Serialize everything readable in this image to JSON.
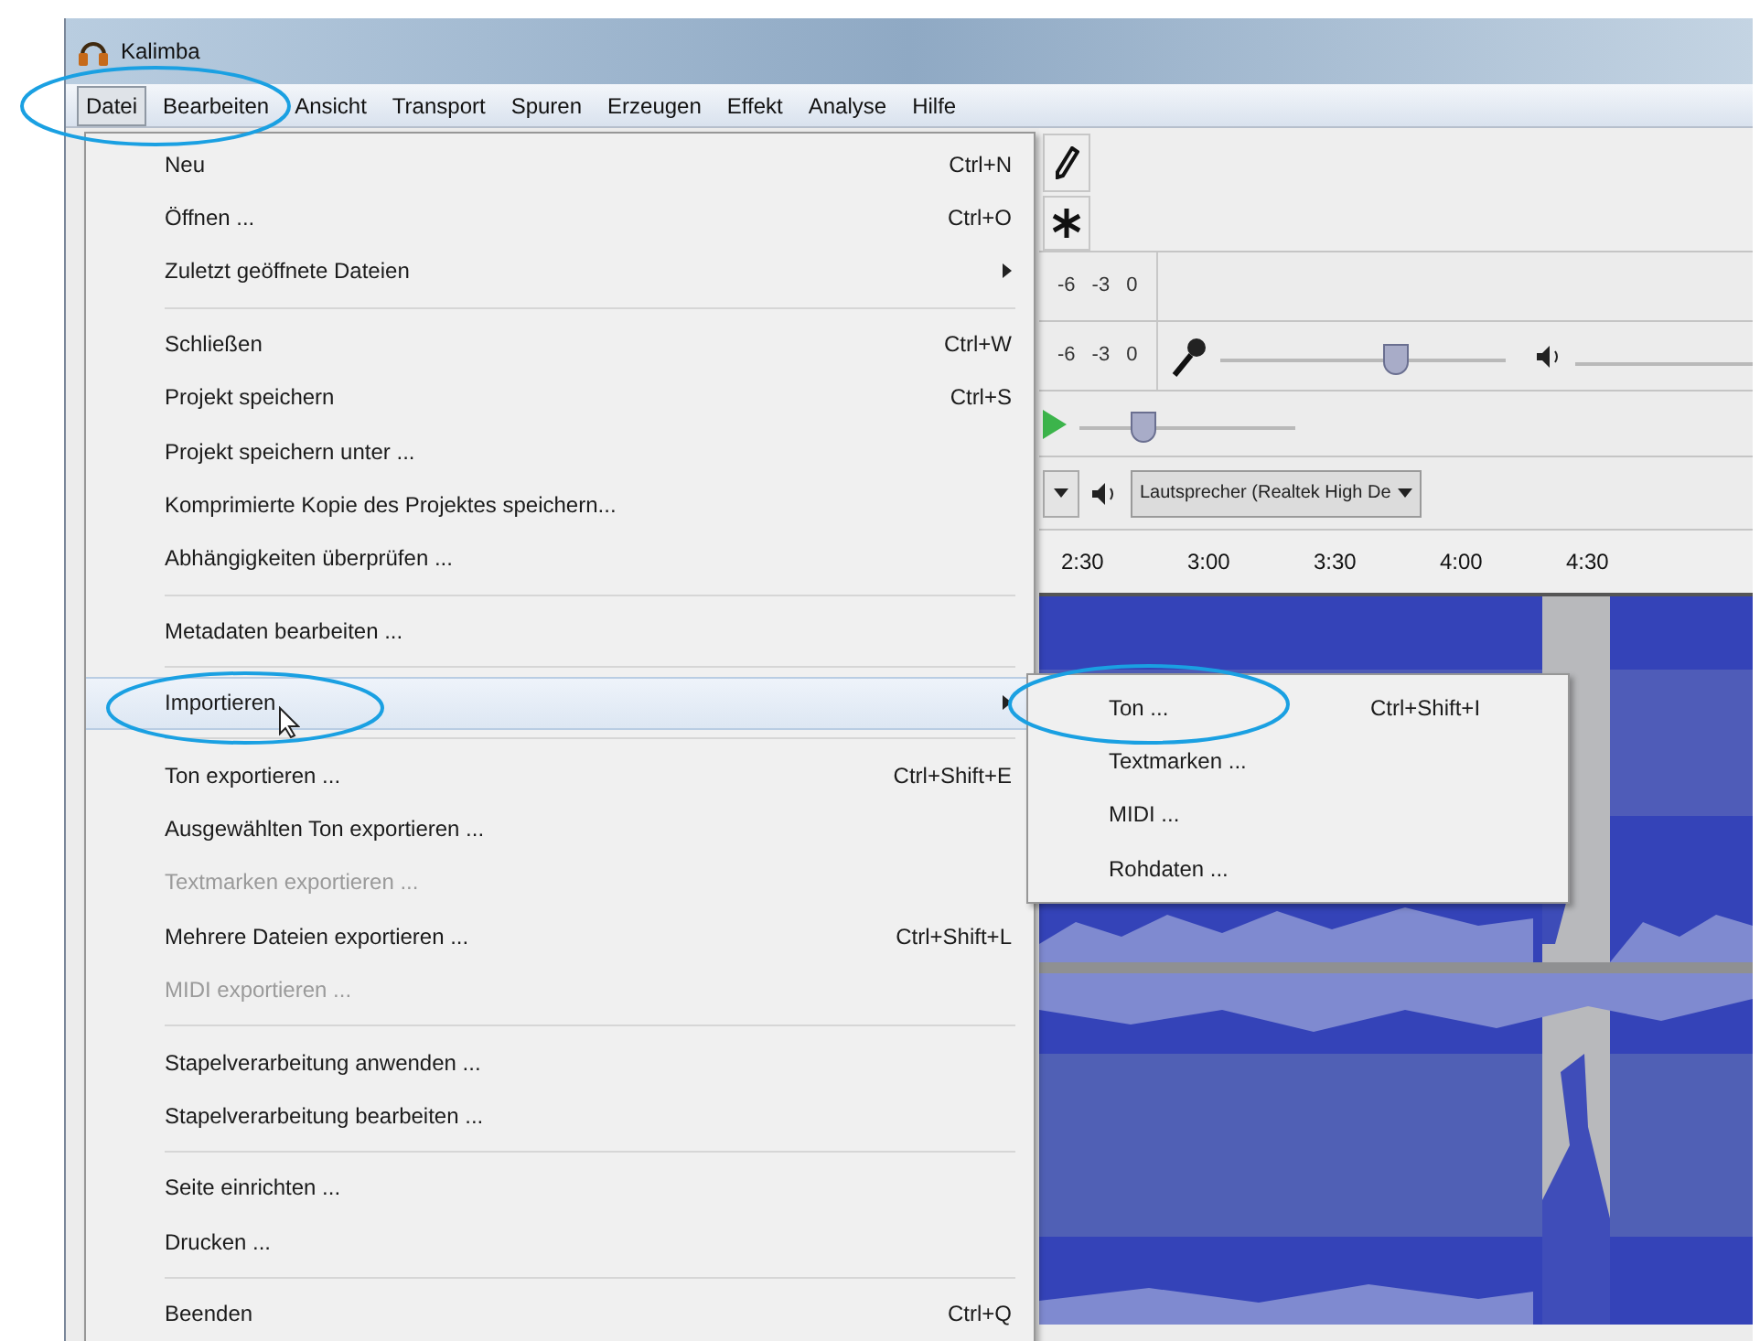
{
  "window": {
    "title": "Kalimba"
  },
  "menu_bar": [
    {
      "label": "Datei",
      "selected": true
    },
    {
      "label": "Bearbeiten",
      "selected": false
    },
    {
      "label": "Ansicht",
      "selected": false
    },
    {
      "label": "Transport",
      "selected": false
    },
    {
      "label": "Spuren",
      "selected": false
    },
    {
      "label": "Erzeugen",
      "selected": false
    },
    {
      "label": "Effekt",
      "selected": false
    },
    {
      "label": "Analyse",
      "selected": false
    },
    {
      "label": "Hilfe",
      "selected": false
    }
  ],
  "file_menu": [
    {
      "kind": "item",
      "label": "Neu",
      "shortcut": "Ctrl+N",
      "disabled": false,
      "selected": false,
      "submenu": false
    },
    {
      "kind": "item",
      "label": "Öffnen ...",
      "shortcut": "Ctrl+O",
      "disabled": false,
      "selected": false,
      "submenu": false
    },
    {
      "kind": "item",
      "label": "Zuletzt geöffnete Dateien",
      "disabled": false,
      "selected": false,
      "submenu": true
    },
    {
      "kind": "separator"
    },
    {
      "kind": "item",
      "label": "Schließen",
      "shortcut": "Ctrl+W",
      "disabled": false,
      "selected": false,
      "submenu": false
    },
    {
      "kind": "item",
      "label": "Projekt speichern",
      "shortcut": "Ctrl+S",
      "disabled": false,
      "selected": false,
      "submenu": false
    },
    {
      "kind": "item",
      "label": "Projekt speichern unter ...",
      "disabled": false,
      "selected": false,
      "submenu": false
    },
    {
      "kind": "item",
      "label": "Komprimierte Kopie des Projektes speichern...",
      "disabled": false,
      "selected": false,
      "submenu": false
    },
    {
      "kind": "item",
      "label": "Abhängigkeiten überprüfen ...",
      "disabled": false,
      "selected": false,
      "submenu": false
    },
    {
      "kind": "separator"
    },
    {
      "kind": "item",
      "label": "Metadaten bearbeiten ...",
      "disabled": false,
      "selected": false,
      "submenu": false
    },
    {
      "kind": "separator"
    },
    {
      "kind": "item",
      "label": "Importieren",
      "disabled": false,
      "selected": true,
      "submenu": true
    },
    {
      "kind": "separator"
    },
    {
      "kind": "item",
      "label": "Ton exportieren ...",
      "shortcut": "Ctrl+Shift+E",
      "disabled": false,
      "selected": false,
      "submenu": false
    },
    {
      "kind": "item",
      "label": "Ausgewählten Ton exportieren ...",
      "disabled": false,
      "selected": false,
      "submenu": false
    },
    {
      "kind": "item",
      "label": "Textmarken exportieren ...",
      "disabled": true,
      "selected": false,
      "submenu": false
    },
    {
      "kind": "item",
      "label": "Mehrere Dateien exportieren ...",
      "shortcut": "Ctrl+Shift+L",
      "disabled": false,
      "selected": false,
      "submenu": false
    },
    {
      "kind": "item",
      "label": "MIDI exportieren ...",
      "disabled": true,
      "selected": false,
      "submenu": false
    },
    {
      "kind": "separator"
    },
    {
      "kind": "item",
      "label": "Stapelverarbeitung anwenden ...",
      "disabled": false,
      "selected": false,
      "submenu": false
    },
    {
      "kind": "item",
      "label": "Stapelverarbeitung bearbeiten ...",
      "disabled": false,
      "selected": false,
      "submenu": false
    },
    {
      "kind": "separator"
    },
    {
      "kind": "item",
      "label": "Seite einrichten ...",
      "disabled": false,
      "selected": false,
      "submenu": false
    },
    {
      "kind": "item",
      "label": "Drucken ...",
      "disabled": false,
      "selected": false,
      "submenu": false
    },
    {
      "kind": "separator"
    },
    {
      "kind": "item",
      "label": "Beenden",
      "shortcut": "Ctrl+Q",
      "disabled": false,
      "selected": false,
      "submenu": false
    }
  ],
  "import_submenu": [
    {
      "label": "Ton ...",
      "shortcut": "Ctrl+Shift+I"
    },
    {
      "label": "Textmarken ..."
    },
    {
      "label": "MIDI ..."
    },
    {
      "label": "Rohdaten ..."
    }
  ],
  "toolbar": {
    "meters": [
      {
        "ticks": [
          "-6",
          "-3",
          "0"
        ]
      },
      {
        "ticks": [
          "-6",
          "-3",
          "0"
        ]
      }
    ],
    "input_volume": {
      "level": 0.62
    },
    "playback_speed": {
      "level": 0.3
    },
    "output_device": {
      "value": "Lautsprecher (Realtek High De"
    }
  },
  "ruler": {
    "ticks": [
      "2:30",
      "3:00",
      "3:30",
      "4:00",
      "4:30"
    ]
  }
}
